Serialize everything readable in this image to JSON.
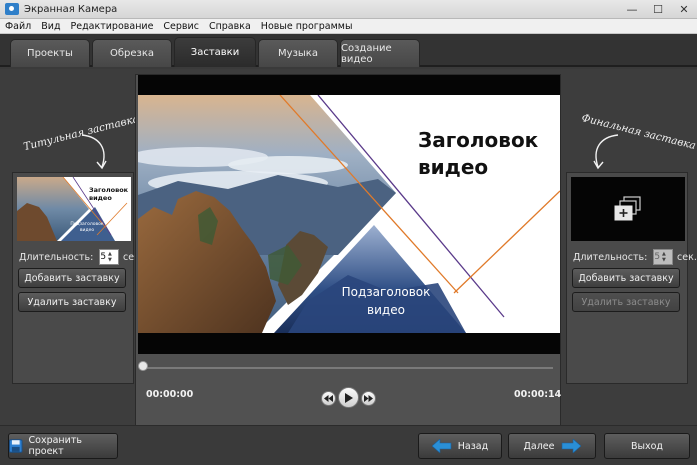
{
  "window": {
    "title": "Экранная Камера",
    "minimize": "—",
    "maximize": "☐",
    "close": "✕"
  },
  "menu": [
    "Файл",
    "Вид",
    "Редактирование",
    "Сервис",
    "Справка",
    "Новые программы"
  ],
  "tabs": [
    {
      "label": "Проекты",
      "active": false
    },
    {
      "label": "Обрезка",
      "active": false
    },
    {
      "label": "Заставки",
      "active": true
    },
    {
      "label": "Музыка",
      "active": false
    },
    {
      "label": "Создание видео",
      "active": false
    }
  ],
  "left_panel": {
    "caption": "Титульная заставка",
    "thumb_title": "Заголовок видео",
    "thumb_subtitle": "Подзаголовок видео",
    "duration_label": "Длительность:",
    "duration_value": "5",
    "duration_unit": "сек.",
    "add_button": "Добавить заставку",
    "remove_button": "Удалить заставку"
  },
  "right_panel": {
    "caption": "Финальная заставка",
    "duration_label": "Длительность:",
    "duration_value": "5",
    "duration_unit": "сек.",
    "add_button": "Добавить заставку",
    "remove_button": "Удалить заставку",
    "remove_disabled": true
  },
  "preview": {
    "title_line1": "Заголовок",
    "title_line2": "видео",
    "subtitle_line1": "Подзаголовок",
    "subtitle_line2": "видео",
    "time_current": "00:00:00",
    "time_total": "00:00:14",
    "progress": 0
  },
  "bottom": {
    "save_button": "Сохранить проект",
    "back_button": "Назад",
    "next_button": "Далее",
    "exit_button": "Выход"
  },
  "colors": {
    "accent_arrow": "#2a8fd6",
    "line_orange": "#e07a2a",
    "line_purple": "#5a3a8a"
  }
}
